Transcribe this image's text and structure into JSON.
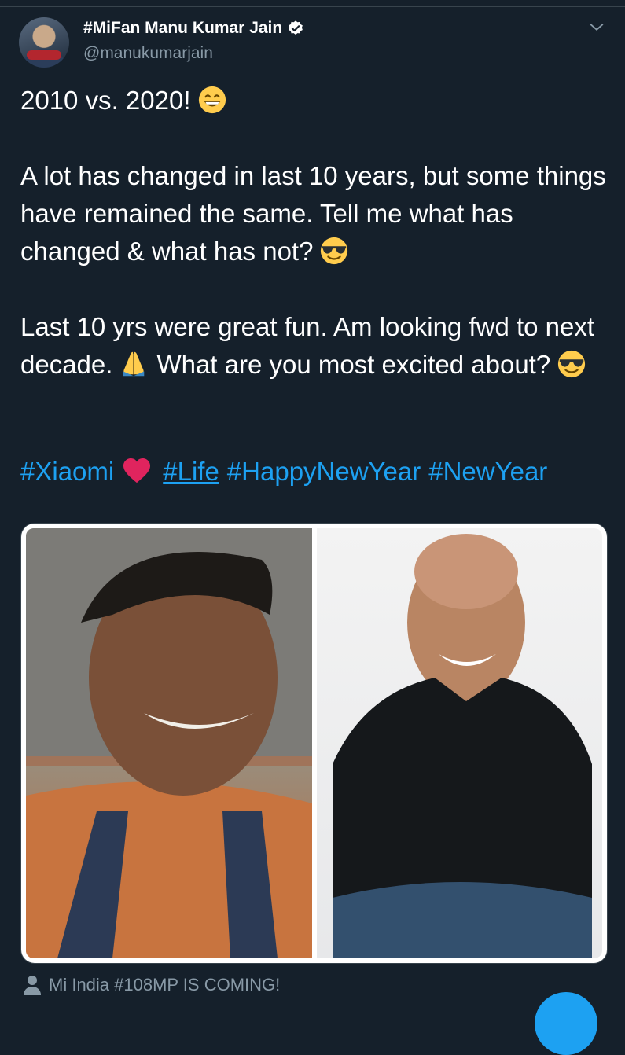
{
  "author": {
    "display_name": "#MiFan Manu Kumar Jain",
    "handle": "@manukumarjain"
  },
  "tweet": {
    "line1": "2010 vs. 2020!",
    "paragraph2": "A lot has changed in last 10 years, but some things have remained the same. Tell me what has changed & what has not?",
    "paragraph3a": "Last 10 yrs were great fun. Am looking fwd to next decade.",
    "paragraph3b": "What are you most excited about?",
    "hashtags": [
      "#Xiaomi",
      "#Life",
      "#HappyNewYear",
      "#NewYear"
    ]
  },
  "media": {
    "left_photo_icon": "person-photo-2010-icon",
    "right_photo_icon": "person-photo-2020-icon"
  },
  "footer": {
    "text": "Mi India #108MP IS COMING!"
  },
  "colors": {
    "background": "#15202b",
    "text": "#ffffff",
    "secondary": "#8899a6",
    "link": "#1da1f2",
    "heart": "#e0245e",
    "emoji": "#ffcc4d"
  }
}
